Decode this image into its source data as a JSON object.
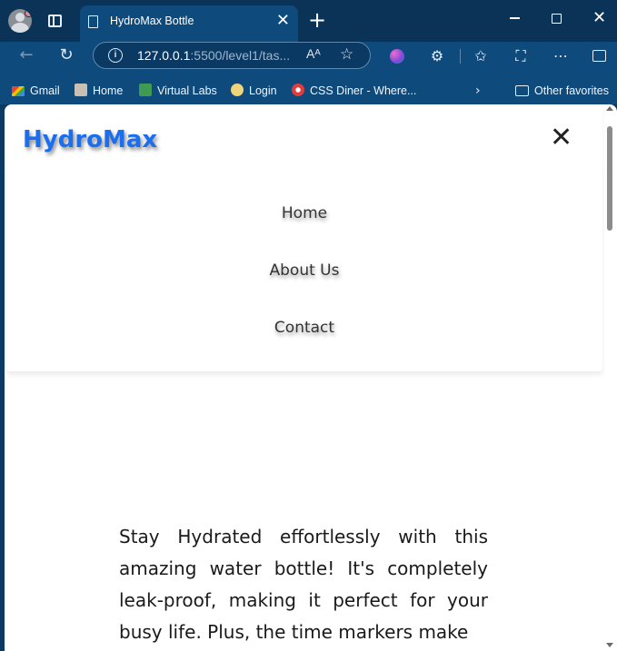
{
  "browser": {
    "tab_title": "HydroMax Bottle",
    "tab_close": "✕",
    "new_tab": "+",
    "url_host": "127.0.0.1",
    "url_rest": ":5500/level1/tas...",
    "read_aloud": "A))",
    "window_close": "✕"
  },
  "bookmarks": {
    "items": [
      {
        "label": "Gmail",
        "icon": "gmail-icon"
      },
      {
        "label": "Home",
        "icon": "home-page-icon"
      },
      {
        "label": "Virtual Labs",
        "icon": "virtual-labs-icon"
      },
      {
        "label": "Login",
        "icon": "login-icon"
      },
      {
        "label": "CSS Diner - Where...",
        "icon": "css-diner-icon"
      }
    ],
    "overflow": "›",
    "other": "Other favorites"
  },
  "site": {
    "logo": "HydroMax",
    "close_menu": "✕",
    "menu": [
      "Home",
      "About Us",
      "Contact"
    ],
    "description": "Stay Hydrated effortlessly with this amazing water bottle! It's completely leak-proof, making it perfect for your busy life. Plus, the time markers make"
  },
  "colors": {
    "logo": "#1a6ef0",
    "browser_frame": "#0f4a7d"
  }
}
